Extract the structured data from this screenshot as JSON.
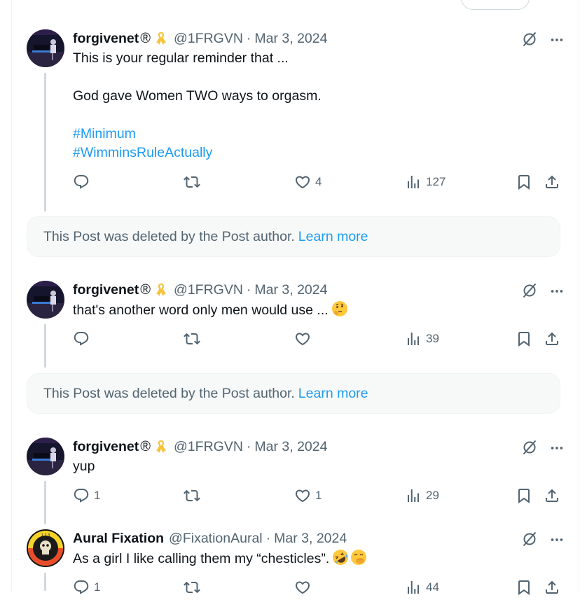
{
  "posts": [
    {
      "name": "forgivenet",
      "reg": "®",
      "handle": "@1FRGVN",
      "sep": "·",
      "date": "Mar 3, 2024",
      "lines": [
        "This is your regular reminder that ...",
        "",
        "God gave Women TWO ways to orgasm.",
        "",
        "#Minimum",
        "#WimminsRuleActually"
      ],
      "replies": "",
      "reposts": "",
      "likes": "4",
      "views": "127"
    },
    {
      "name": "forgivenet",
      "reg": "®",
      "handle": "@1FRGVN",
      "sep": "·",
      "date": "Mar 3, 2024",
      "text": "that's another word only men would use ...",
      "emoji": "thinking-face",
      "replies": "",
      "reposts": "",
      "likes": "",
      "views": "39"
    },
    {
      "name": "forgivenet",
      "reg": "®",
      "handle": "@1FRGVN",
      "sep": "·",
      "date": "Mar 3, 2024",
      "text": "yup",
      "replies": "1",
      "reposts": "",
      "likes": "1",
      "views": "29"
    },
    {
      "name": "Aural Fixation",
      "handle": "@FixationAural",
      "sep": "·",
      "date": "Mar 3, 2024",
      "text": "As a girl I like calling them my “chesticles”.",
      "emoji": [
        "rolling-on-floor-laughing",
        "face-with-hand-over-mouth"
      ],
      "replies": "1",
      "reposts": "",
      "likes": "",
      "views": "44"
    }
  ],
  "deleted_notice": {
    "text": "This Post was deleted by the Post author.",
    "link": "Learn more"
  },
  "colors": {
    "text": "#0f1419",
    "secondary": "#536471",
    "link": "#1d9bf0",
    "thread_line": "#cfd9de",
    "notice_bg": "#f7f9f9"
  },
  "icons": [
    "reply-icon",
    "repost-icon",
    "like-icon",
    "views-icon",
    "bookmark-icon",
    "share-icon",
    "grok-icon",
    "more-icon",
    "ribbon-icon"
  ]
}
